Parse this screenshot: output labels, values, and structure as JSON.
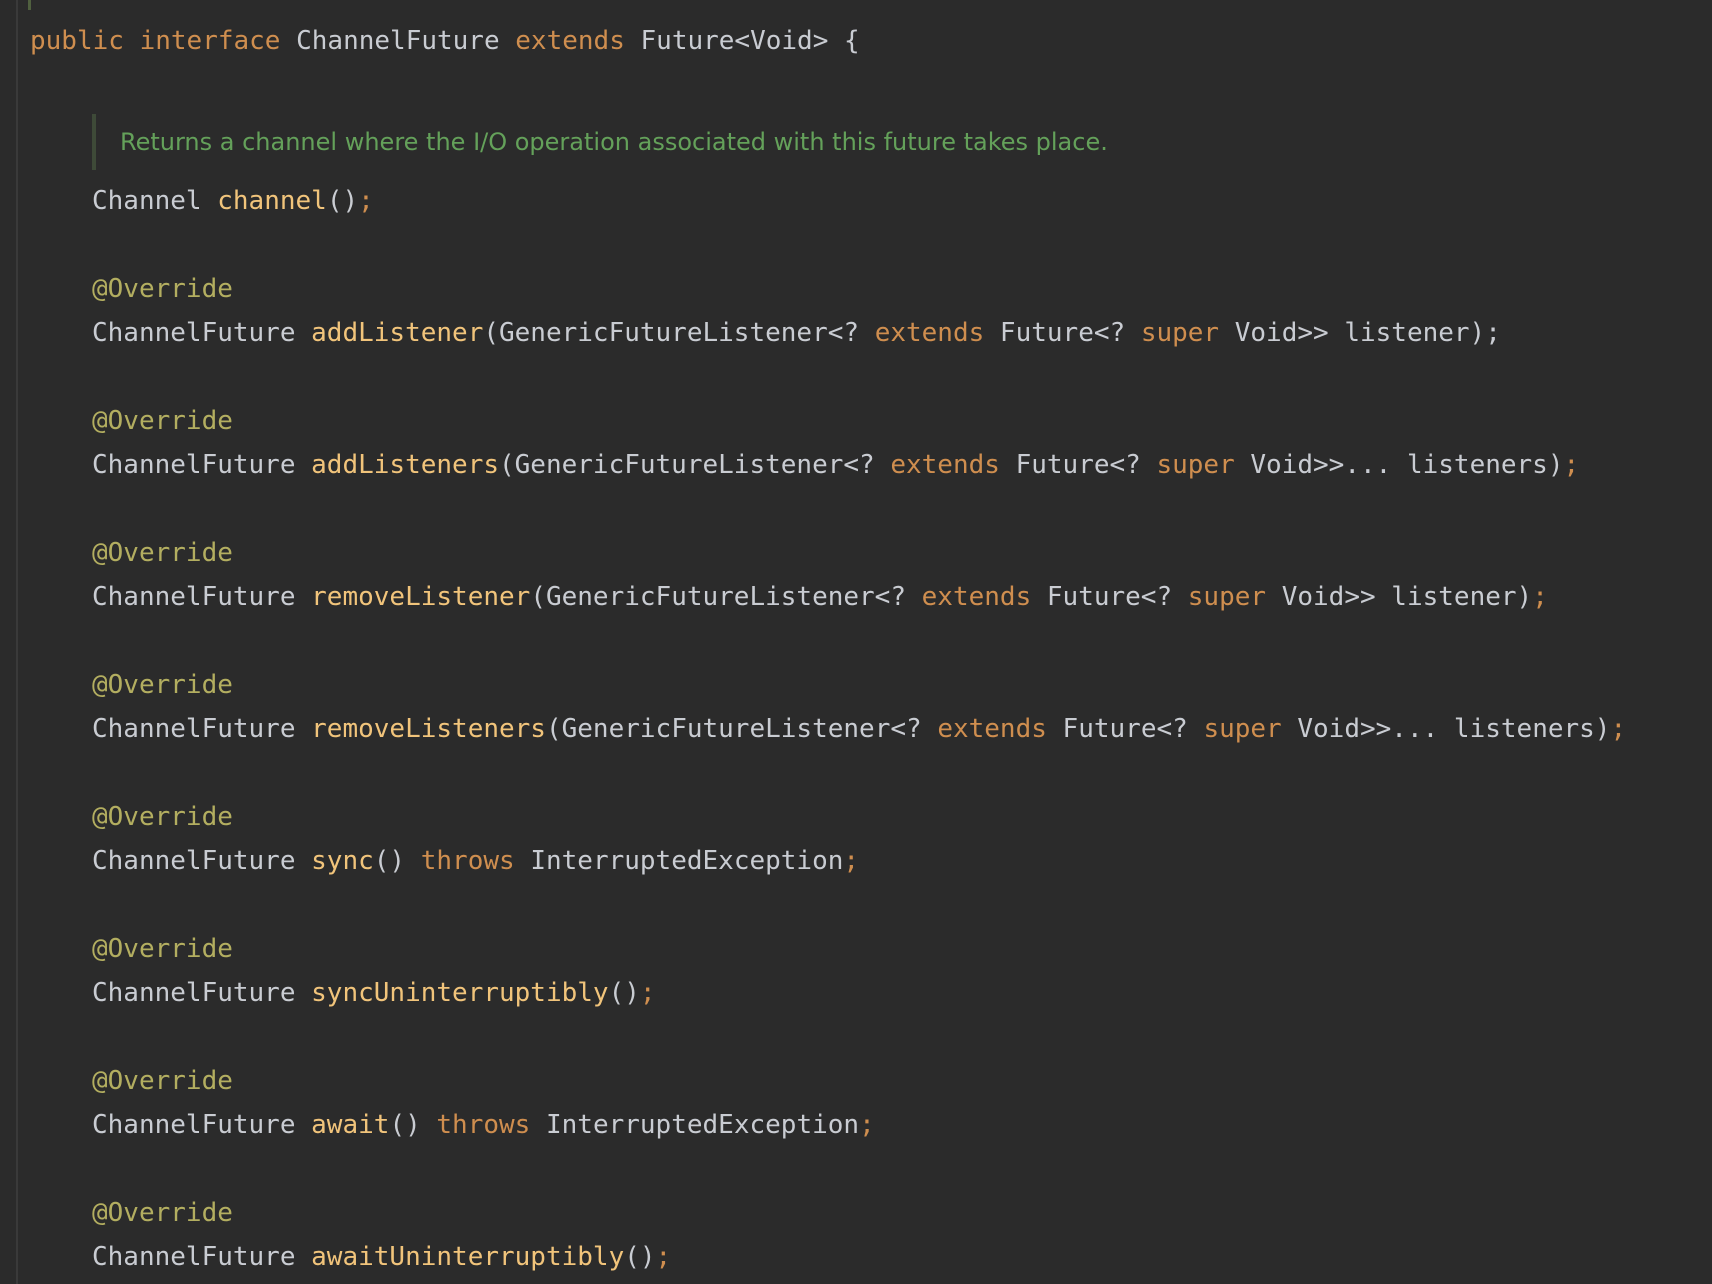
{
  "colors": {
    "background": "#2b2b2b",
    "keyword": "#cf8e4f",
    "type": "#c9ccd2",
    "method": "#f1c47b",
    "annotation": "#b3ae60",
    "doc_comment": "#64a15a",
    "semicolon": "#cf8e4f"
  },
  "decl": {
    "public": "public",
    "interface": "interface",
    "name": "ChannelFuture",
    "extends": "extends",
    "super_type": "Future<Void>",
    "brace": "{"
  },
  "doc_comment": "Returns a channel where the I/O operation associated with this future takes place.",
  "channel_method": {
    "return_type": "Channel",
    "name": "channel",
    "params": "()",
    "semicolon": ";"
  },
  "tokens": {
    "annotation": "@Override",
    "return_type": "ChannelFuture",
    "listener_type": "(GenericFutureListener<?",
    "extends": "extends",
    "future_type": "Future<?",
    "super": "super",
    "void_single": "Void>>",
    "void_varargs": "Void>>...",
    "throws": "throws",
    "exception": "InterruptedException",
    "semicolon": ";"
  },
  "methods": [
    {
      "name": "addListener",
      "param_name": "listener);"
    },
    {
      "name": "addListeners",
      "param_name": "listeners)"
    },
    {
      "name": "removeListener",
      "param_name": "listener)"
    },
    {
      "name": "removeListeners",
      "param_name": "listeners)"
    },
    {
      "name": "sync",
      "params": "()"
    },
    {
      "name": "syncUninterruptibly",
      "params": "()"
    },
    {
      "name": "await",
      "params": "()"
    },
    {
      "name": "awaitUninterruptibly",
      "params": "()"
    }
  ]
}
